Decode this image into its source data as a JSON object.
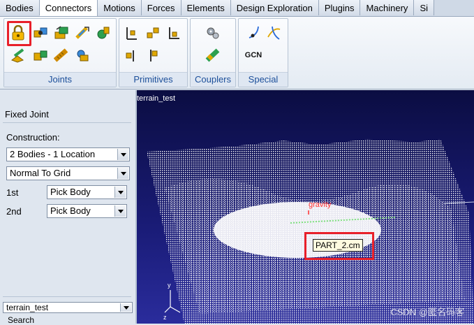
{
  "tabs": [
    "Bodies",
    "Connectors",
    "Motions",
    "Forces",
    "Elements",
    "Design Exploration",
    "Plugins",
    "Machinery",
    "Si"
  ],
  "active_tab": "Connectors",
  "ribbon": {
    "groups": [
      {
        "label": "Joints",
        "icons": [
          "fixed-joint-icon",
          "revolute-joint-icon",
          "translational-joint-icon",
          "cylindrical-joint-icon",
          "spherical-joint-icon",
          "planar-joint-icon",
          "constant-velocity-joint-icon",
          "screw-joint-icon",
          "hooke-joint-icon"
        ]
      },
      {
        "label": "Primitives",
        "icons": [
          "inline-primitive-icon",
          "inplane-primitive-icon",
          "orientation-primitive-icon",
          "parallel-axes-primitive-icon",
          "perpendicular-primitive-icon"
        ]
      },
      {
        "label": "Couplers",
        "icons": [
          "gear-coupler-icon",
          "coupler-icon"
        ]
      },
      {
        "label": "Special",
        "icons": [
          "point-curve-icon",
          "curve-curve-icon",
          "general-constraint-icon"
        ]
      }
    ],
    "gcn_text": "GCN"
  },
  "panel": {
    "title": "Fixed Joint",
    "construction_label": "Construction:",
    "construction_value": "2 Bodies - 1 Location",
    "orientation_value": "Normal To Grid",
    "first_label": "1st",
    "first_value": "Pick Body",
    "second_label": "2nd",
    "second_value": "Pick Body",
    "model_selector": "terrain_test",
    "search_label": "Search"
  },
  "viewport": {
    "model_name": "terrain_test",
    "gravity_label": "gravity",
    "marker_label": "PART_2.cm",
    "axis_y": "y",
    "axis_z": "z",
    "watermark": "CSDN @匿名码客"
  },
  "colors": {
    "highlight": "#e8202a",
    "accent": "#1c4f9a",
    "viewport_top": "#0b0d42",
    "viewport_bottom": "#2a2c9c"
  }
}
